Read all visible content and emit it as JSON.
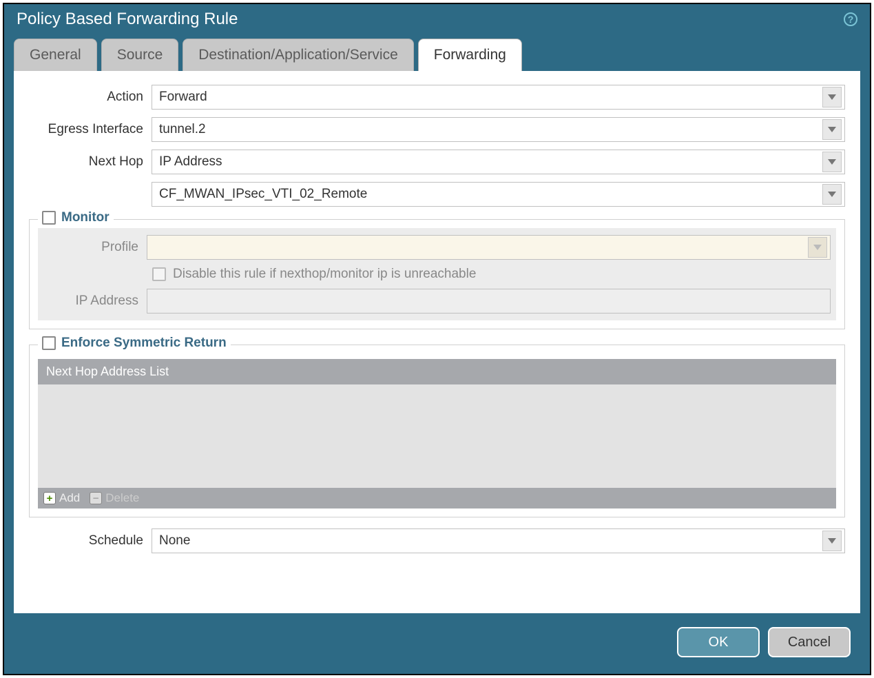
{
  "dialog": {
    "title": "Policy Based Forwarding Rule"
  },
  "tabs": {
    "general": "General",
    "source": "Source",
    "dest": "Destination/Application/Service",
    "forwarding": "Forwarding"
  },
  "fields": {
    "action": {
      "label": "Action",
      "value": "Forward"
    },
    "egress": {
      "label": "Egress Interface",
      "value": "tunnel.2"
    },
    "nexthop": {
      "label": "Next Hop",
      "value": "IP Address"
    },
    "nexthop_addr": {
      "value": "CF_MWAN_IPsec_VTI_02_Remote"
    },
    "schedule": {
      "label": "Schedule",
      "value": "None"
    }
  },
  "monitor": {
    "legend": "Monitor",
    "profile_label": "Profile",
    "profile_value": "",
    "disable_text": "Disable this rule if nexthop/monitor ip is unreachable",
    "ip_label": "IP Address",
    "ip_value": ""
  },
  "symmetric": {
    "legend": "Enforce Symmetric Return",
    "list_header": "Next Hop Address List",
    "add": "Add",
    "delete": "Delete"
  },
  "buttons": {
    "ok": "OK",
    "cancel": "Cancel"
  }
}
